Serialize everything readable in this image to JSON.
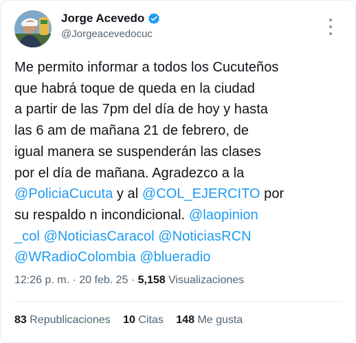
{
  "user": {
    "display_name": "Jorge Acevedo",
    "handle": "@Jorgeacevedocuc",
    "verified_color": "#1d9bf0"
  },
  "tweet": {
    "lines": [
      [
        {
          "t": "Me permito informar a todos los Cucuteños"
        }
      ],
      [
        {
          "t": "que habrá toque de queda en la ciudad"
        }
      ],
      [
        {
          "t": "a partir de las 7pm del día de hoy y hasta"
        }
      ],
      [
        {
          "t": "las 6 am de mañana 21 de febrero, de"
        }
      ],
      [
        {
          "t": "igual manera se suspenderán las clases"
        }
      ],
      [
        {
          "t": "por el día de mañana. Agradezco a la"
        }
      ],
      [
        {
          "t": "@PoliciaCucuta",
          "m": true
        },
        {
          "t": " y al "
        },
        {
          "t": "@COL_EJERCITO",
          "m": true
        },
        {
          "t": " por"
        }
      ],
      [
        {
          "t": "su respaldo n incondicional. "
        },
        {
          "t": "@laopinion",
          "m": true
        }
      ],
      [
        {
          "t": "_col",
          "m": true
        },
        {
          "t": " "
        },
        {
          "t": "@NoticiasCaracol",
          "m": true
        },
        {
          "t": " "
        },
        {
          "t": "@NoticiasRCN",
          "m": true
        }
      ],
      [
        {
          "t": "@WRadioColombia",
          "m": true
        },
        {
          "t": " "
        },
        {
          "t": "@blueradio",
          "m": true
        }
      ]
    ]
  },
  "meta": {
    "time": "12:26 p. m.",
    "sep": " · ",
    "date": "20 feb. 25",
    "views_count": "5,158",
    "views_label": " Visualizaciones"
  },
  "stats": {
    "reposts_count": "83",
    "reposts_label": "Republicaciones",
    "quotes_count": "10",
    "quotes_label": "Citas",
    "likes_count": "148",
    "likes_label": "Me gusta"
  },
  "colors": {
    "link": "#1d9bf0",
    "text": "#0f1419",
    "secondary": "#536471"
  }
}
